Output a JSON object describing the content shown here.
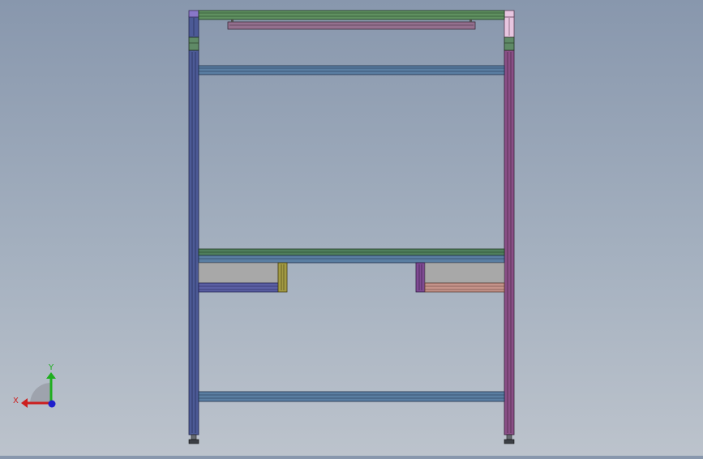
{
  "axis_triad": {
    "x_label": "X",
    "y_label": "Y"
  },
  "colors": {
    "left_post": "#4c5a96",
    "right_post": "#8a4f86",
    "top_rail": "#5f9060",
    "top_inner_bar": "#94708e",
    "upper_rail": "#5a7ea2",
    "mid_rail_top": "#4f7e5c",
    "mid_rail_bottom": "#5a7ea2",
    "bottom_rail": "#5a7ea2",
    "drawer_left_bar": "#5b5fa4",
    "drawer_left_post": "#a39b43",
    "drawer_right_post": "#7f4a93",
    "drawer_right_bar": "#c5938a",
    "drawer_panel": "#a8a8a8",
    "corner_left_top": "#8877c8",
    "corner_right_top": "#e8c6e0",
    "bracket": "#5f8a66",
    "axis_x": "#cc1f1f",
    "axis_y": "#1fae1f",
    "axis_z": "#1f1fcc"
  }
}
